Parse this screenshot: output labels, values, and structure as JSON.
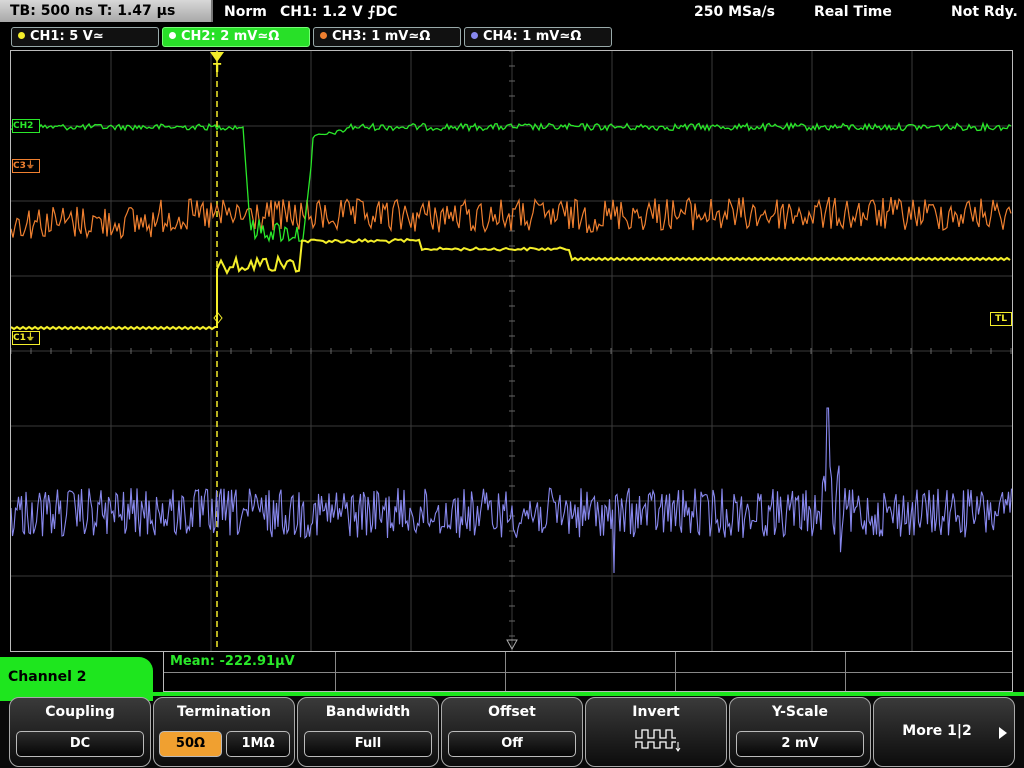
{
  "status": {
    "timebase": "TB: 500 ns   T: 1.47 µs",
    "mode": "Norm",
    "trigger": "CH1: 1.2 V ⨍DC",
    "sample_rate": "250 MSa/s",
    "acq_mode": "Real Time",
    "state": "Not Rdy."
  },
  "channels": [
    {
      "label": "CH1: 5 V≃",
      "color": "#f4ee2a"
    },
    {
      "label": "CH2: 2 mV≃Ω",
      "color": "#2ae82a"
    },
    {
      "label": "CH3: 1 mV≃Ω",
      "color": "#f08030"
    },
    {
      "label": "CH4: 1 mV≃Ω",
      "color": "#8888ee"
    }
  ],
  "markers": {
    "ch2": "CH2",
    "ch3": "C3⏚",
    "ch1": "C1⏚",
    "trigger_level": "TL",
    "trigger_pos": "T"
  },
  "measurement": {
    "mean": "Mean: -222.91µV"
  },
  "menu": {
    "title": "Channel 2",
    "coupling": {
      "label": "Coupling",
      "value": "DC"
    },
    "termination": {
      "label": "Termination",
      "opt1": "50Ω",
      "opt2": "1MΩ",
      "selected": "50Ω"
    },
    "bandwidth": {
      "label": "Bandwidth",
      "value": "Full"
    },
    "offset": {
      "label": "Offset",
      "value": "Off"
    },
    "invert": {
      "label": "Invert",
      "icon": "square-wave-icon"
    },
    "yscale": {
      "label": "Y-Scale",
      "value": "2 mV"
    },
    "more": {
      "label": "More 1|2"
    }
  }
}
